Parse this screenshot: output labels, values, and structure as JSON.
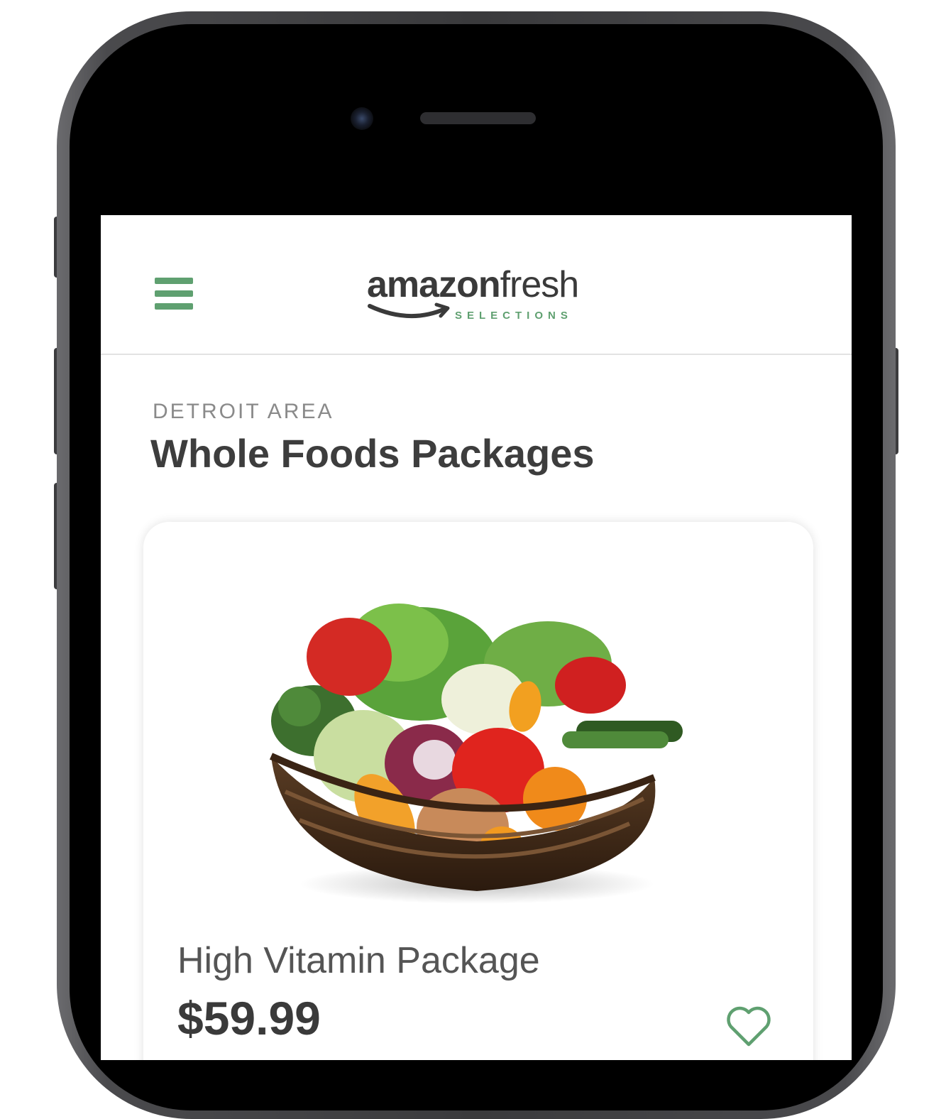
{
  "theme": {
    "accent": "#5fa070",
    "text_dark": "#3d3d3d",
    "text_muted": "#8a8a8a"
  },
  "header": {
    "menu_icon": "hamburger-menu-icon",
    "logo_part1": "amazon",
    "logo_part2": "fresh",
    "logo_sub": "SELECTIONS"
  },
  "page": {
    "eyebrow": "DETROIT AREA",
    "title": "Whole Foods Packages"
  },
  "product": {
    "image_icon": "vegetable-basket-image",
    "name": "High Vitamin Package",
    "price": "$59.99",
    "favorite_icon": "heart-icon"
  }
}
